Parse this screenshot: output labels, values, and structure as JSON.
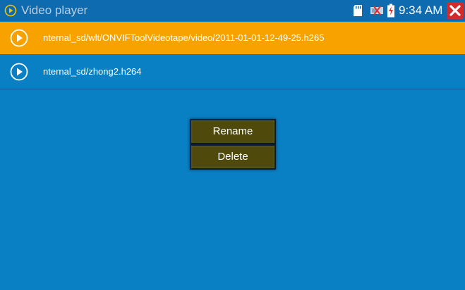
{
  "app": {
    "title": "Video player",
    "icon": "play-circle-icon"
  },
  "status": {
    "time": "9:34 AM",
    "icons": [
      "sd-card-icon",
      "network-disconnected-icon",
      "battery-charging-icon",
      "close-icon"
    ],
    "colors": {
      "close": "#d42a2a"
    }
  },
  "files": [
    {
      "label": "nternal_sd/wlt/ONVIFToolVideotape/video/2011-01-01-12-49-25.h265",
      "selected": true,
      "icon": "play-arrow-icon"
    },
    {
      "label": "nternal_sd/zhong2.h264",
      "selected": false,
      "icon": "play-arrow-icon"
    }
  ],
  "context_menu": {
    "rename_label": "Rename",
    "delete_label": "Delete"
  },
  "colors": {
    "background": "#0a80c4",
    "statusbar": "#0e6bb0",
    "selected_row": "#f8a200",
    "menu_button": "#4f4a0c"
  }
}
